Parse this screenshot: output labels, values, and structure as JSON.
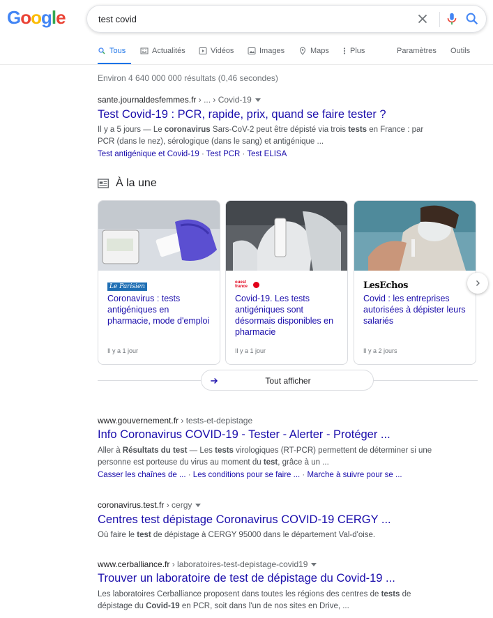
{
  "header": {
    "logo_letters": [
      {
        "ch": "G",
        "color": "#4285f4"
      },
      {
        "ch": "o",
        "color": "#ea4335"
      },
      {
        "ch": "o",
        "color": "#fbbc05"
      },
      {
        "ch": "g",
        "color": "#4285f4"
      },
      {
        "ch": "l",
        "color": "#34a853"
      },
      {
        "ch": "e",
        "color": "#ea4335"
      }
    ],
    "query": "test covid"
  },
  "tabs": {
    "all": "Tous",
    "news": "Actualités",
    "videos": "Vidéos",
    "images": "Images",
    "maps": "Maps",
    "more": "Plus",
    "settings": "Paramètres",
    "tools": "Outils"
  },
  "stats": "Environ 4 640 000 000 résultats (0,46 secondes)",
  "results": [
    {
      "domain": "sante.journaldesfemmes.fr",
      "path": " › ... › Covid-19",
      "title": "Test Covid-19 : PCR, rapide, prix, quand se faire tester ?",
      "snippet_html_parts": {
        "p1": "Il y a 5 jours — Le ",
        "b1": "coronavirus",
        "p2": " Sars-CoV-2 peut être dépisté via trois ",
        "b2": "tests",
        "p3": " en France : par PCR (dans le nez), sérologique (dans le sang) et antigénique ..."
      },
      "links": [
        "Test antigénique et Covid-19",
        "Test PCR",
        "Test ELISA"
      ]
    },
    {
      "domain": "www.gouvernement.fr",
      "path": " › tests-et-depistage",
      "title": "Info Coronavirus COVID-19 - Tester - Alerter - Protéger ...",
      "snippet_html_parts": {
        "p1": "Aller à ",
        "b1": "Résultats du test",
        "p2": " — Les ",
        "b2": "tests",
        "p3": " virologiques (RT-PCR) permettent de déterminer si une personne est porteuse du virus au moment du ",
        "b3": "test",
        "p4": ", grâce à un ..."
      },
      "links": [
        "Casser les chaînes de ...",
        "Les conditions pour se faire ...",
        "Marche à suivre pour se ..."
      ]
    },
    {
      "domain": "coronavirus.test.fr",
      "path": " › cergy",
      "title": "Centres test dépistage Coronavirus COVID-19 CERGY ...",
      "snippet_html_parts": {
        "p1": "Où faire le ",
        "b1": "test",
        "p2": " de dépistage à CERGY 95000 dans le département Val-d'oise."
      }
    },
    {
      "domain": "www.cerballiance.fr",
      "path": " › laboratoires-test-depistage-covid19",
      "title": "Trouver un laboratoire de test de dépistage du Covid-19 ...",
      "snippet_html_parts": {
        "p1": "Les laboratoires Cerballiance proposent dans toutes les régions des centres de ",
        "b1": "tests",
        "p2": " de dépistage du ",
        "b2": "Covid-19",
        "p3": " en PCR, soit dans l'un de nos sites en Drive, ..."
      }
    }
  ],
  "top_stories": {
    "title": "À la une",
    "cards": [
      {
        "publisher": "Le Parisien",
        "headline": "Coronavirus : tests antigéniques en pharmacie, mode d'emploi",
        "age": "Il y a 1 jour"
      },
      {
        "publisher": "ouest france",
        "headline": "Covid-19. Les tests antigéniques sont désormais disponibles en pharmacie",
        "age": "Il y a 1 jour"
      },
      {
        "publisher": "LesEchos",
        "headline": "Covid : les entreprises autorisées à dépister leurs salariés",
        "age": "Il y a 2 jours"
      }
    ],
    "show_all": "Tout afficher"
  },
  "colors": {
    "link": "#1a0dab",
    "accent": "#1a73e8"
  }
}
